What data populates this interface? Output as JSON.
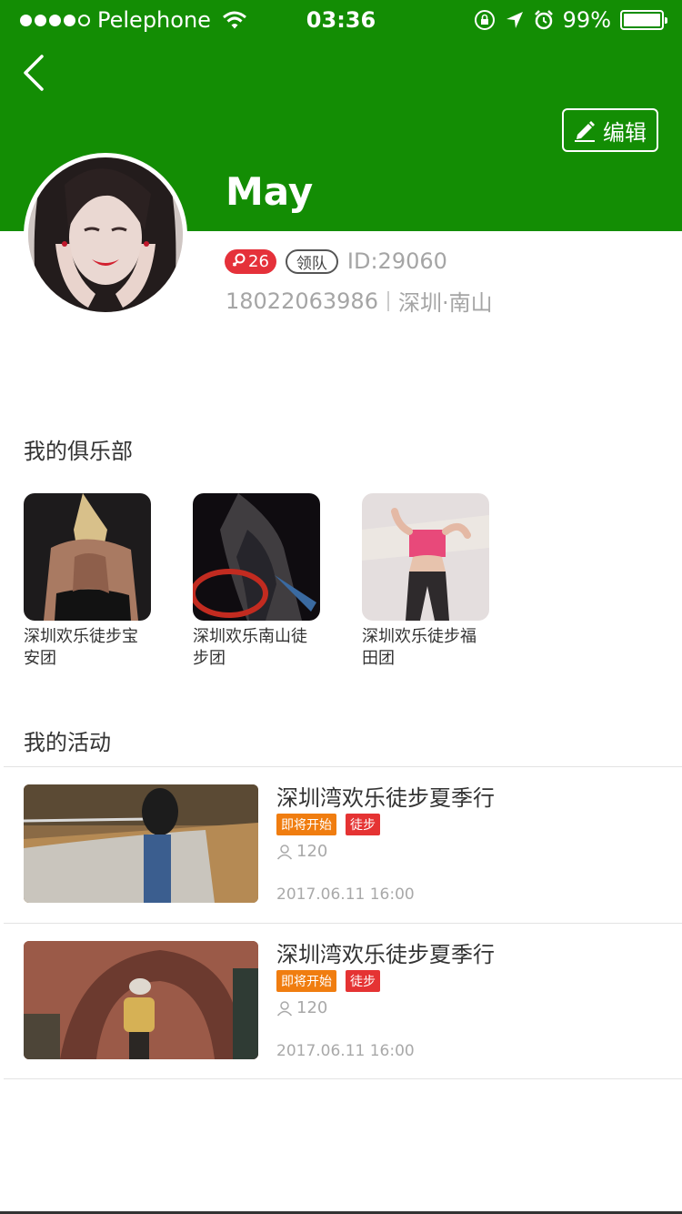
{
  "status_bar": {
    "carrier": "Pelephone",
    "time": "03:36",
    "battery": "99%",
    "battery_level": 0.99,
    "signal_bars": 4
  },
  "header": {
    "background": "#138d04",
    "back_icon": "chevron-left-icon",
    "edit_icon": "pencil-icon",
    "edit_label": "编辑"
  },
  "profile": {
    "name": "May",
    "gender_icon": "female-icon",
    "age": "26",
    "role": "领队",
    "id": "ID:29060",
    "phone": "18022063986",
    "location": "深圳·南山"
  },
  "clubs": {
    "title": "我的俱乐部",
    "items": [
      {
        "name": "深圳欢乐徒步宝安团"
      },
      {
        "name": "深圳欢乐南山徒步团"
      },
      {
        "name": "深圳欢乐徒步福田团"
      }
    ]
  },
  "activities": {
    "title": "我的活动",
    "items": [
      {
        "title": "深圳湾欢乐徒步夏季行",
        "status_tag": "即将开始",
        "type_tag": "徒步",
        "participants": "120",
        "datetime": "2017.06.11 16:00"
      },
      {
        "title": "深圳湾欢乐徒步夏季行",
        "status_tag": "即将开始",
        "type_tag": "徒步",
        "participants": "120",
        "datetime": "2017.06.11 16:00"
      }
    ]
  }
}
